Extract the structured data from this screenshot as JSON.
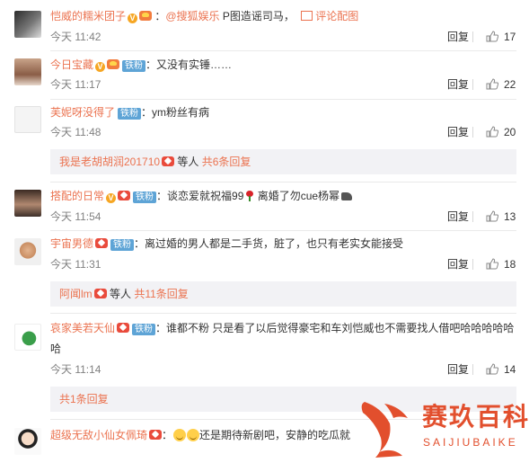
{
  "comments": [
    {
      "user": "恺威的糯米团子",
      "badges": [
        "v",
        "vip"
      ],
      "mention": "@搜狐娱乐",
      "text": " P图造谣司马，",
      "extra_link": "评论配图",
      "time": "今天 11:42",
      "reply": "回复",
      "likes": "17"
    },
    {
      "user": "今日宝藏",
      "badges": [
        "v",
        "vip",
        "fan"
      ],
      "text": "：又没有实锤……",
      "time": "今天 11:17",
      "reply": "回复",
      "likes": "22"
    },
    {
      "user": "芙妮呀没得了",
      "badges": [
        "fan"
      ],
      "text": "：ym粉丝有病",
      "time": "今天 11:48",
      "reply": "回复",
      "likes": "20",
      "subreply": {
        "user": "我是老胡胡润201710",
        "text": " 等人 ",
        "link": "共6条回复"
      }
    },
    {
      "user": "搭配的日常",
      "badges": [
        "v",
        "heart",
        "fan"
      ],
      "text": "：谈恋爱就祝福99",
      "text2": " 离婚了勿cue杨幂",
      "time": "今天 11:54",
      "reply": "回复",
      "likes": "13"
    },
    {
      "user": "宇宙男德",
      "badges": [
        "heart",
        "fan"
      ],
      "text": "：离过婚的男人都是二手货，脏了，也只有老实女能接受",
      "time": "今天 11:31",
      "reply": "回复",
      "likes": "18",
      "subreply": {
        "user": "阿闻lm",
        "text": " 等人 ",
        "link": "共11条回复"
      }
    },
    {
      "user": "哀家美若天仙",
      "badges": [
        "heart",
        "fan"
      ],
      "text": "：谁都不粉 只是看了以后觉得豪宅和车刘恺威也不需要找人借吧哈哈哈哈哈",
      "text_cont": "哈",
      "time": "今天 11:14",
      "reply": "回复",
      "likes": "14",
      "subreply": {
        "link": "共1条回复"
      }
    },
    {
      "user": "超级无敌小仙女佩琦",
      "badges": [
        "heart"
      ],
      "text": "：",
      "text2": "还是期待新剧吧，安静的吃瓜就"
    }
  ],
  "badge_labels": {
    "v": "V",
    "fan": "铁粉"
  },
  "watermark": {
    "title": "赛玖百科",
    "sub": "SAIJIUBAIKE"
  },
  "colors": {
    "username": "#eb7350",
    "fan_badge": "#5ea4d6",
    "watermark": "#e24f2d"
  }
}
